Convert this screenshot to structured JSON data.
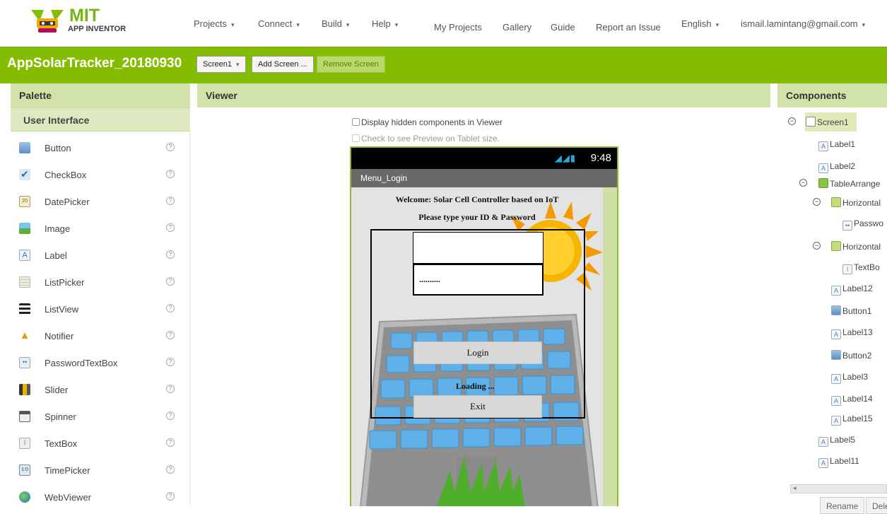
{
  "nav": {
    "logo_title": "MIT",
    "logo_subtitle": "APP INVENTOR",
    "menus": [
      "Projects",
      "Connect",
      "Build",
      "Help"
    ],
    "links": [
      "My Projects",
      "Gallery",
      "Guide",
      "Report an Issue"
    ],
    "language": "English",
    "account": "ismail.lamintang@gmail.com"
  },
  "project": {
    "name": "AppSolarTracker_20180930",
    "screen_select": "Screen1",
    "add_screen": "Add Screen ...",
    "remove_screen": "Remove Screen"
  },
  "palette": {
    "title": "Palette",
    "section": "User Interface",
    "items": [
      {
        "label": "Button",
        "icon": "button-icon"
      },
      {
        "label": "CheckBox",
        "icon": "checkbox-icon"
      },
      {
        "label": "DatePicker",
        "icon": "datepicker-icon"
      },
      {
        "label": "Image",
        "icon": "image-icon"
      },
      {
        "label": "Label",
        "icon": "label-icon"
      },
      {
        "label": "ListPicker",
        "icon": "listpicker-icon"
      },
      {
        "label": "ListView",
        "icon": "listview-icon"
      },
      {
        "label": "Notifier",
        "icon": "notifier-icon"
      },
      {
        "label": "PasswordTextBox",
        "icon": "passwordtextbox-icon"
      },
      {
        "label": "Slider",
        "icon": "slider-icon"
      },
      {
        "label": "Spinner",
        "icon": "spinner-icon"
      },
      {
        "label": "TextBox",
        "icon": "textbox-icon"
      },
      {
        "label": "TimePicker",
        "icon": "timepicker-icon"
      },
      {
        "label": "WebViewer",
        "icon": "webviewer-icon"
      }
    ],
    "help_glyph": "?"
  },
  "viewer": {
    "title": "Viewer",
    "display_hidden": "Display hidden components in Viewer",
    "tablet_preview": "Check to see Preview on Tablet size.",
    "phone": {
      "time": "9:48",
      "screen_title": "Menu_Login",
      "welcome": "Welcome: Solar Cell Controller based on IoT",
      "prompt": "Please type your ID & Password",
      "password_mask": "..........",
      "login_label": "Login",
      "loading_label": "Loading ...",
      "exit_label": "Exit"
    }
  },
  "components": {
    "title": "Components",
    "tree": [
      {
        "label": "Screen1",
        "selected": true
      },
      {
        "label": "Label1"
      },
      {
        "label": "Label2"
      },
      {
        "label": "TableArrange"
      },
      {
        "label": "Horizontal"
      },
      {
        "label": "Passwo"
      },
      {
        "label": "Horizontal"
      },
      {
        "label": "TextBo"
      },
      {
        "label": "Label12"
      },
      {
        "label": "Button1"
      },
      {
        "label": "Label13"
      },
      {
        "label": "Button2"
      },
      {
        "label": "Label3"
      },
      {
        "label": "Label14"
      },
      {
        "label": "Label15"
      },
      {
        "label": "Label5"
      },
      {
        "label": "Label11"
      }
    ],
    "rename": "Rename",
    "delete": "Dele"
  },
  "colors": {
    "accent_green": "#84bd00",
    "panel_header": "#d1e3a8"
  }
}
